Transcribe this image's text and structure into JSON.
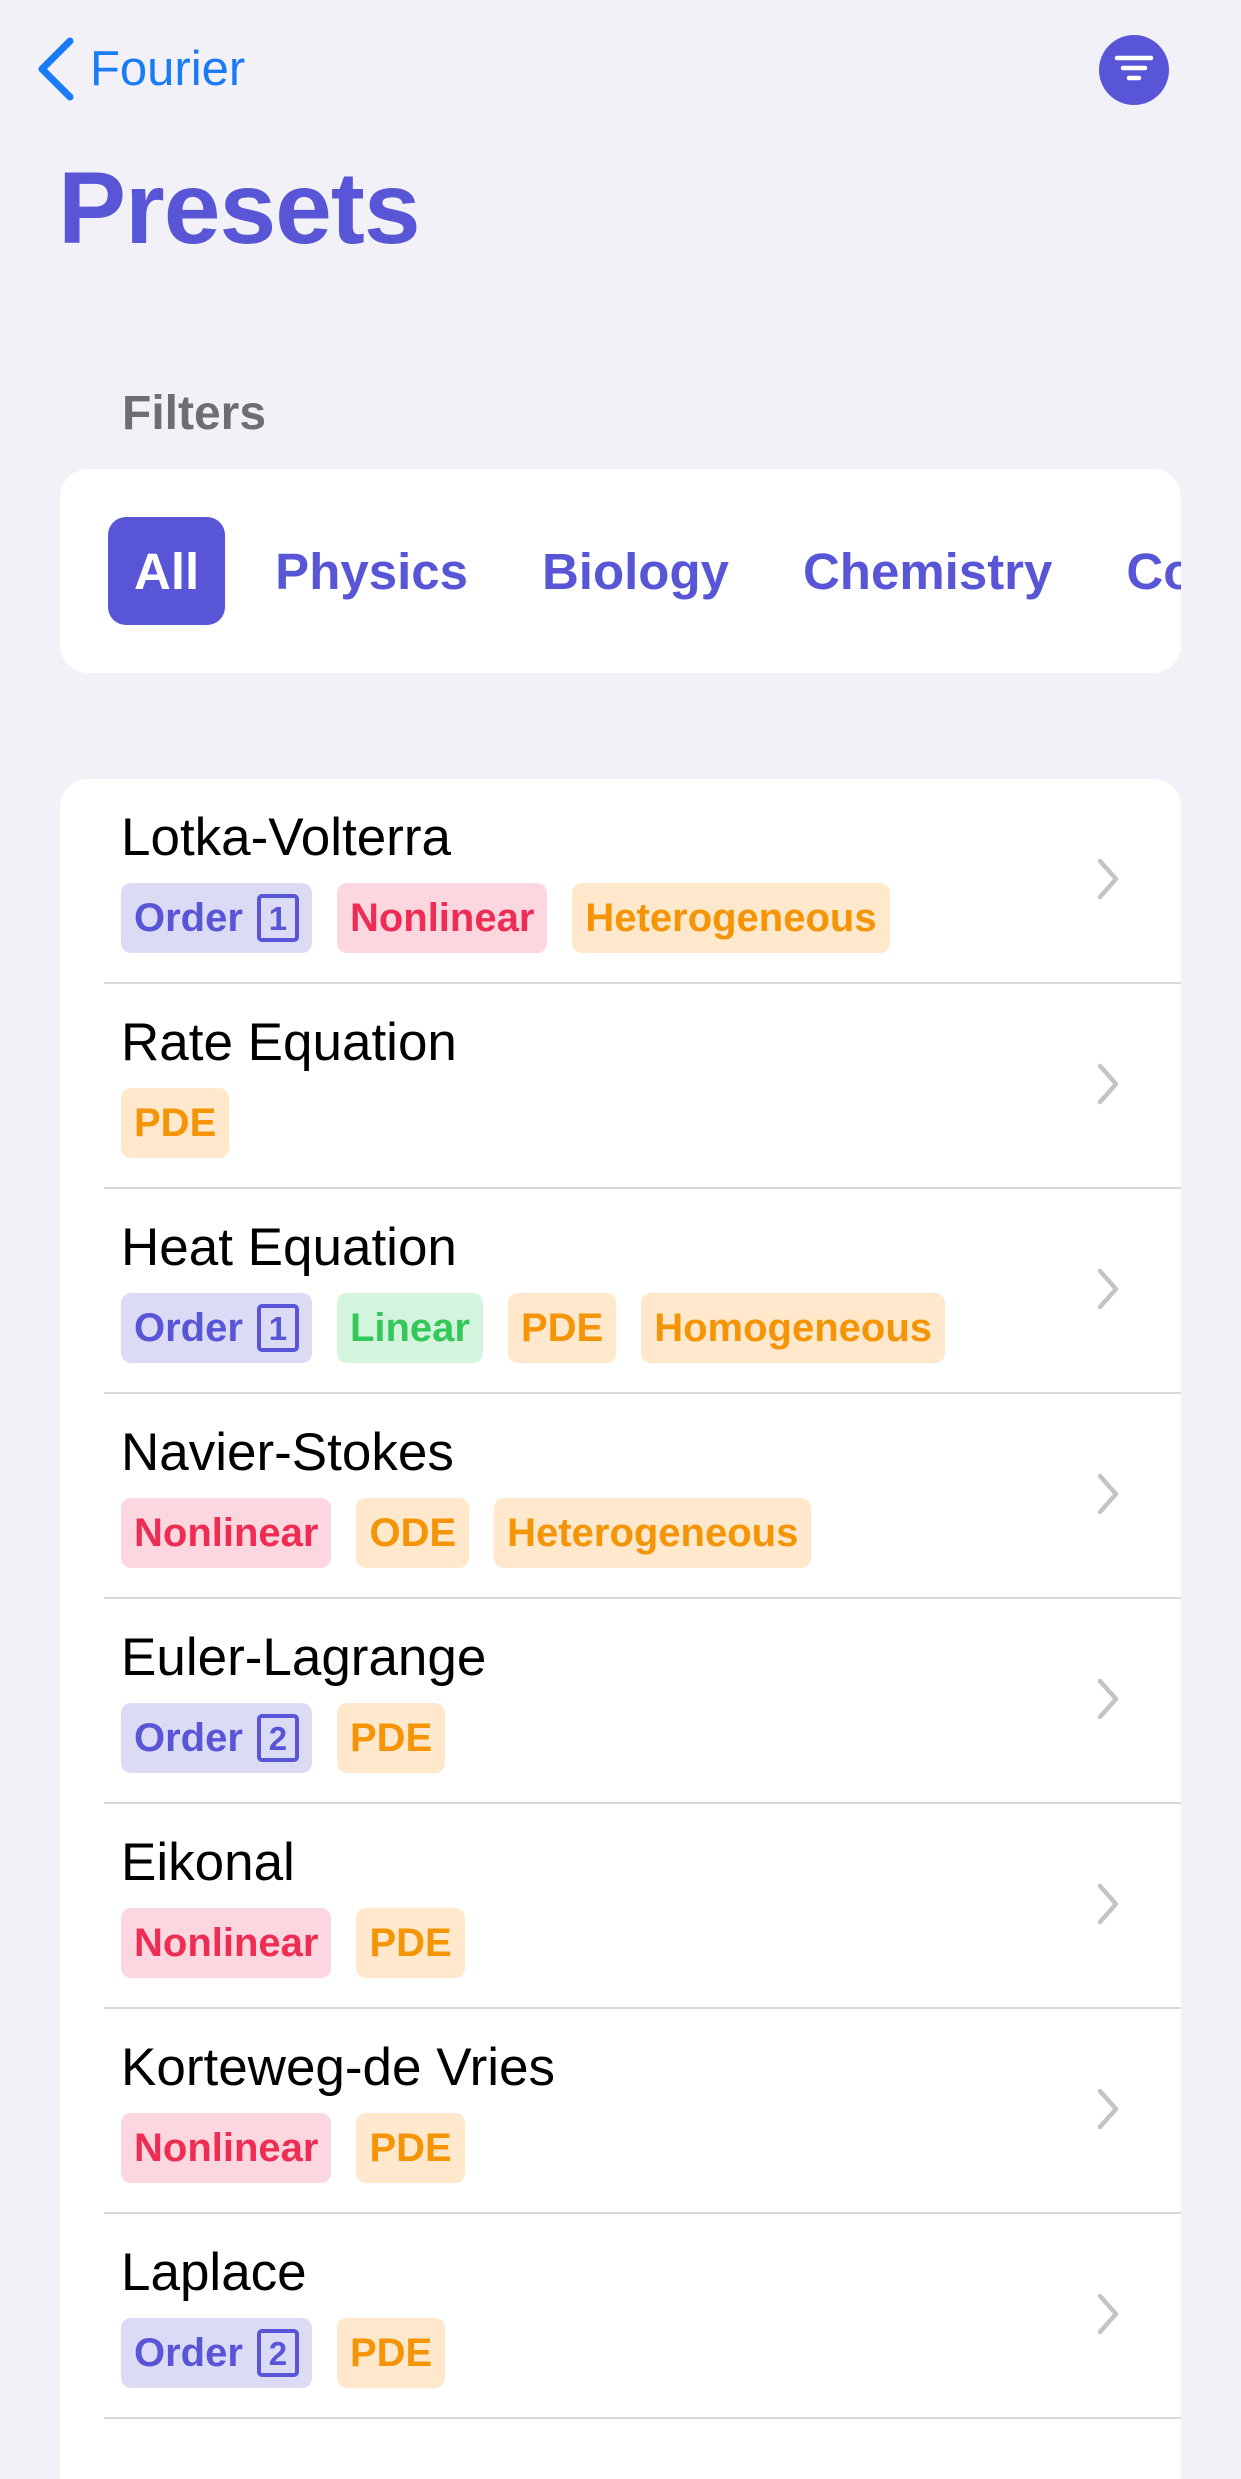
{
  "nav": {
    "back_label": "Fourier",
    "back_icon": "chevron-left-icon",
    "menu_icon": "filter-lines-icon"
  },
  "title": "Presets",
  "filters": {
    "header": "Filters",
    "chips": [
      "All",
      "Physics",
      "Biology",
      "Chemistry",
      "Con"
    ],
    "selected": "All"
  },
  "colors": {
    "accent": "#5856d6",
    "link": "#1a7cf5",
    "red": "#ee2d55",
    "green": "#34c759",
    "orange": "#f59404"
  },
  "presets": [
    {
      "title": "Lotka-Volterra",
      "tags": [
        {
          "kind": "order",
          "label": "Order",
          "value": "1"
        },
        {
          "kind": "nonlinear",
          "label": "Nonlinear"
        },
        {
          "kind": "orange",
          "label": "Heterogeneous"
        }
      ]
    },
    {
      "title": "Rate Equation",
      "tags": [
        {
          "kind": "orange",
          "label": "PDE"
        }
      ]
    },
    {
      "title": "Heat Equation",
      "tags": [
        {
          "kind": "order",
          "label": "Order",
          "value": "1"
        },
        {
          "kind": "linear",
          "label": "Linear"
        },
        {
          "kind": "orange",
          "label": "PDE"
        },
        {
          "kind": "orange",
          "label": "Homogeneous"
        }
      ]
    },
    {
      "title": "Navier-Stokes",
      "tags": [
        {
          "kind": "nonlinear",
          "label": "Nonlinear"
        },
        {
          "kind": "orange",
          "label": "ODE"
        },
        {
          "kind": "orange",
          "label": "Heterogeneous"
        }
      ]
    },
    {
      "title": "Euler-Lagrange",
      "tags": [
        {
          "kind": "order",
          "label": "Order",
          "value": "2"
        },
        {
          "kind": "orange",
          "label": "PDE"
        }
      ]
    },
    {
      "title": "Eikonal",
      "tags": [
        {
          "kind": "nonlinear",
          "label": "Nonlinear"
        },
        {
          "kind": "orange",
          "label": "PDE"
        }
      ]
    },
    {
      "title": "Korteweg-de Vries",
      "tags": [
        {
          "kind": "nonlinear",
          "label": "Nonlinear"
        },
        {
          "kind": "orange",
          "label": "PDE"
        }
      ]
    },
    {
      "title": "Laplace",
      "tags": [
        {
          "kind": "order",
          "label": "Order",
          "value": "2"
        },
        {
          "kind": "orange",
          "label": "PDE"
        }
      ]
    }
  ]
}
